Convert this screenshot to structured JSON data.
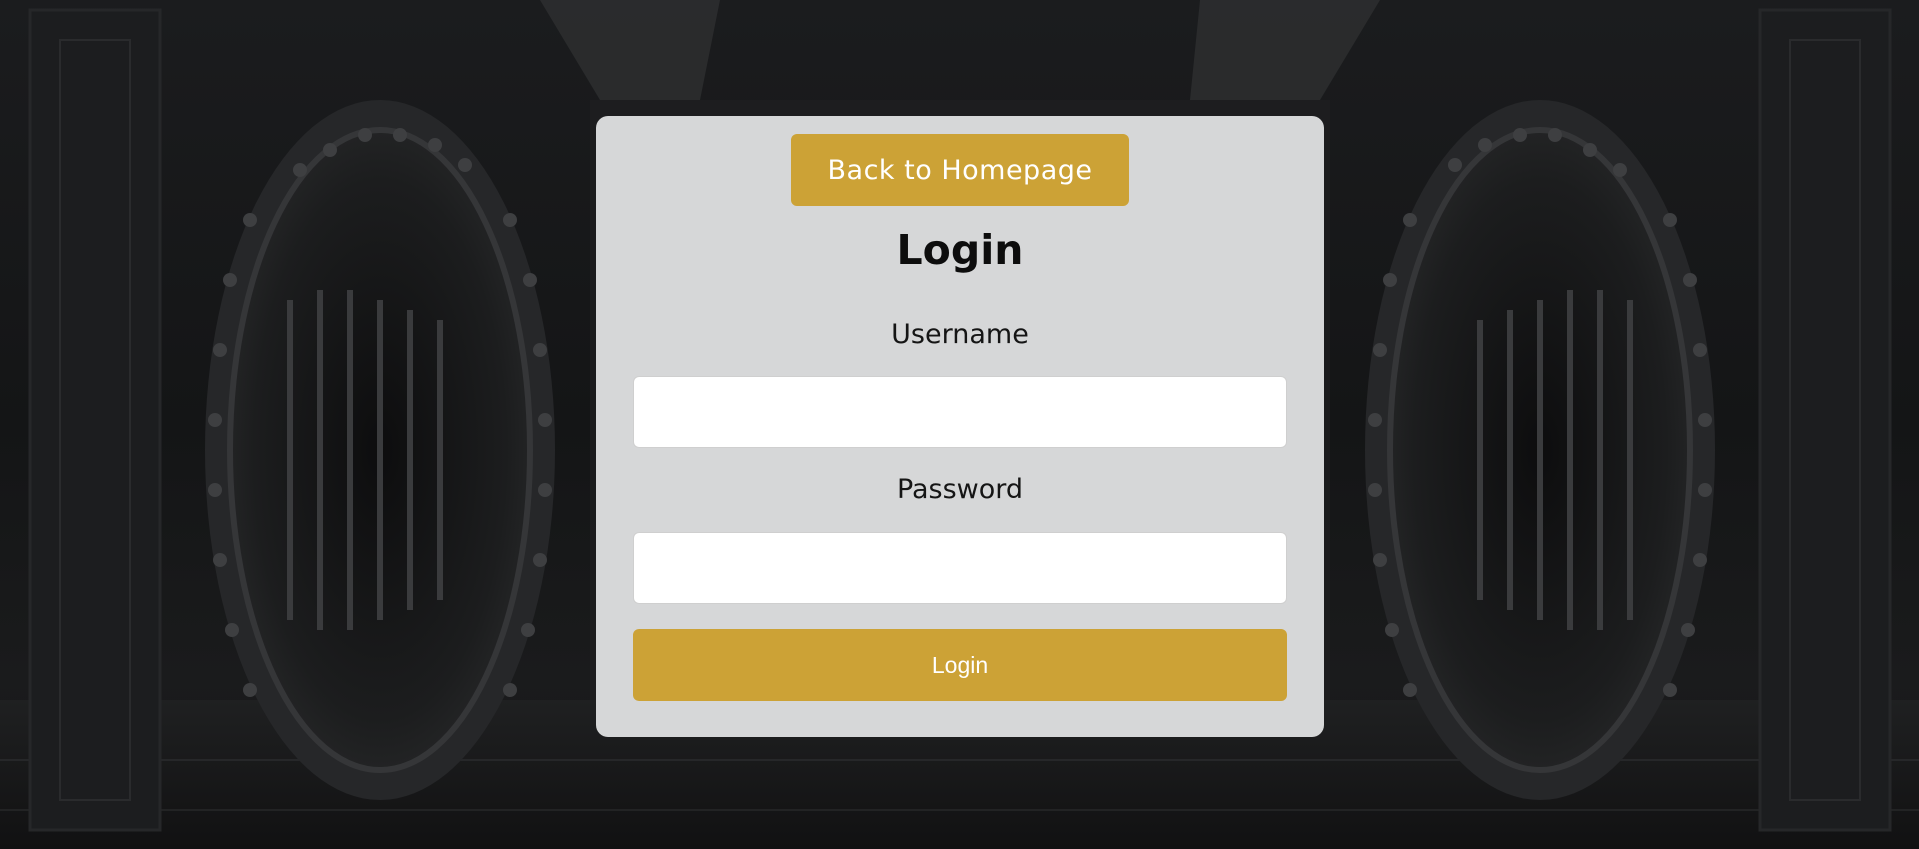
{
  "page": {
    "background": "bank-vault-doors-image"
  },
  "login_card": {
    "back_button_label": "Back to Homepage",
    "title": "Login",
    "username_label": "Username",
    "username_value": "",
    "password_label": "Password",
    "password_value": "",
    "submit_label": "Login"
  },
  "colors": {
    "accent": "#cca236",
    "card_background": "#e4e5e6",
    "page_background": "#161718"
  }
}
